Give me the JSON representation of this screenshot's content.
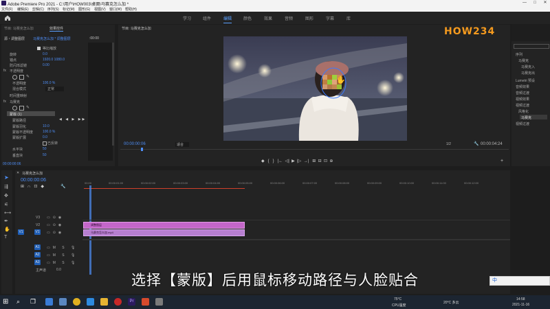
{
  "window": {
    "title": "Adobe Premiere Pro 2021 - C:\\用户\\HOW003\\桌面\\马赛克怎么加 *",
    "controls": [
      "—",
      "□",
      "✕"
    ]
  },
  "menu": [
    "文件(F)",
    "编辑(E)",
    "剪辑(C)",
    "序列(S)",
    "标记(M)",
    "图形(G)",
    "视图(V)",
    "窗口(W)",
    "帮助(H)"
  ],
  "workspaces": {
    "tabs": [
      "学习",
      "组件",
      "编辑",
      "颜色",
      "效果",
      "音频",
      "图形",
      "字幕",
      "库"
    ],
    "active_index": 2
  },
  "effect_controls": {
    "tab_source": "节目: 马赛克怎么加",
    "tab_effects": "效果控件",
    "master_label": "源・调整图层",
    "sequence_label": "马赛克怎么加 * 调整图层",
    "time": ":00:00",
    "rows": [
      {
        "label": "等比缩放",
        "value": ""
      },
      {
        "label": "旋转",
        "value": "0.0"
      },
      {
        "label": "锚点",
        "value": "1920.0    1080.0"
      },
      {
        "label": "防闪烁滤镜",
        "value": "0.00"
      },
      {
        "label": "不透明度",
        "value": ""
      },
      {
        "label": "不透明度",
        "value": "100.0 %"
      },
      {
        "label": "混合模式",
        "value": "正常"
      },
      {
        "label": "时间重映射",
        "value": ""
      },
      {
        "label": "马赛克",
        "value": ""
      },
      {
        "label": "蒙版 (1)",
        "value": ""
      },
      {
        "label": "蒙版路径",
        "value": ""
      },
      {
        "label": "蒙版羽化",
        "value": "10.0"
      },
      {
        "label": "蒙版不透明度",
        "value": "100.0 %"
      },
      {
        "label": "蒙版扩展",
        "value": "0.0"
      },
      {
        "label": "已反转",
        "value": ""
      },
      {
        "label": "水平块",
        "value": "50"
      },
      {
        "label": "垂直块",
        "value": "50"
      }
    ],
    "timecode": "00:00:00:06"
  },
  "program": {
    "tab": "节目: 马赛克怎么加",
    "timecode": "00:00:00:06",
    "fit": "适合",
    "quality": "1/2",
    "duration": "00:00:04:24",
    "transport": [
      "◆",
      "{",
      "}",
      "|←",
      "◁|",
      "▶",
      "|▷",
      "→|",
      "⊞",
      "⊟",
      "⊡",
      "⊕",
      "+"
    ]
  },
  "project": {
    "items": [
      "序列",
      "马赛克",
      "马赛克入",
      "马赛克出",
      "Lumetri 预设",
      "音频效果",
      "音频过渡",
      "视频效果",
      "视频过渡",
      "风格化",
      "马赛克",
      "视频过渡"
    ]
  },
  "timeline": {
    "tab": "马赛克怎么加",
    "timecode": "00:00:00:06",
    "ruler": [
      "00:00",
      "00:00:01:00",
      "00:00:02:00",
      "00:00:03:00",
      "00:00:04:00",
      "00:00:05:00",
      "00:00:06:00",
      "00:00:07:00",
      "00:00:08:00",
      "00:00:09:00",
      "00:00:10:00",
      "00:00:11:00",
      "00:00:12:00"
    ],
    "video_tracks": [
      "V3",
      "V2",
      "V1"
    ],
    "audio_tracks": [
      "A1",
      "A2",
      "A3"
    ],
    "master": "主声道",
    "master_value": "0.0",
    "clip_v2": "调整图层",
    "clip_v1": "马赛克怎么加.mp4"
  },
  "subtitle": "选择【蒙版】后用鼠标移动路径与人脸贴合",
  "watermark": "HOW234",
  "taskbar": {
    "weather": "75°C",
    "weather_sub": "CPU温度",
    "temp": "20°C 多云",
    "time": "14:58",
    "date": "2021-11-16",
    "ime": "中"
  }
}
